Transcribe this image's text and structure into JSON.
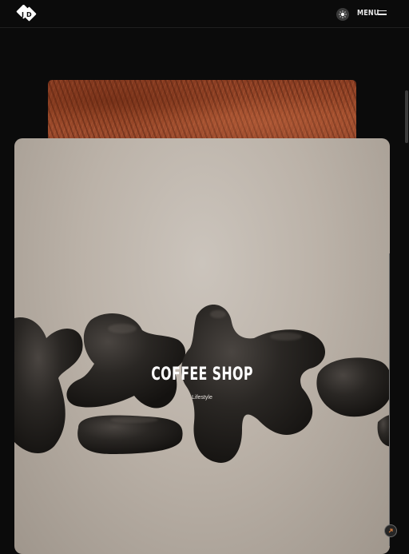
{
  "header": {
    "logo_icon": "jd-monogram-logo",
    "theme_toggle_icon": "sun-icon",
    "menu_label": "MENU",
    "menu_icon": "hamburger-icon"
  },
  "project": {
    "title": "COFFEE SHOP",
    "category": "Lifestyle"
  },
  "colors": {
    "background": "#0b0b0b",
    "card_back": "#9a482a",
    "card_main": "#c2bab1"
  }
}
